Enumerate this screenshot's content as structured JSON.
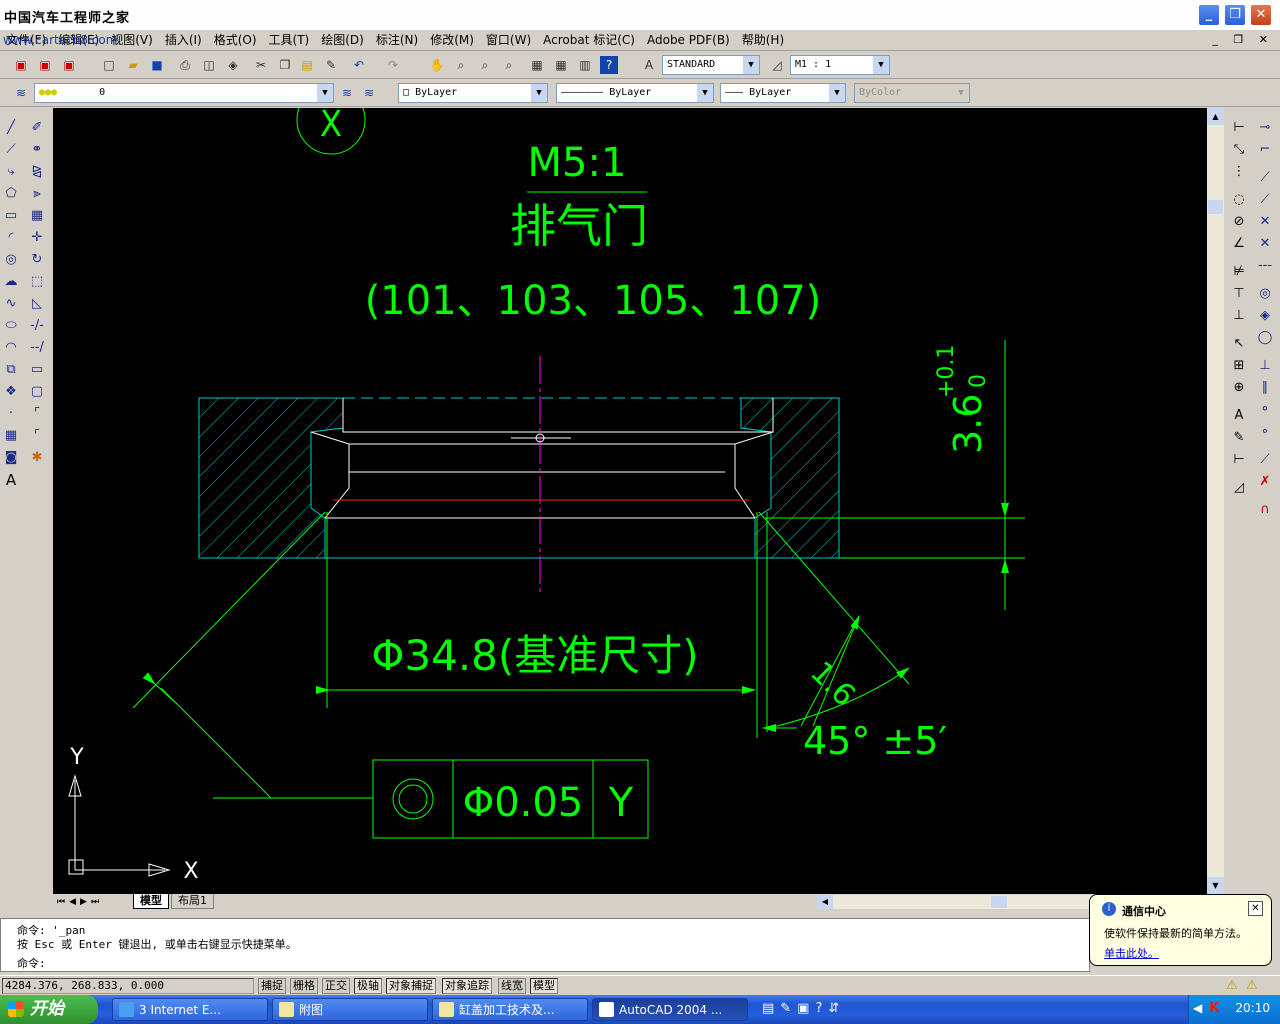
{
  "window": {
    "title": "中国汽车工程师之家",
    "url_overlay": "www.cartech8.com",
    "controls": [
      "_",
      "❐",
      "✕"
    ],
    "mdi_controls": "_ ❐ ✕"
  },
  "menu": [
    "文件(F)",
    "编辑(E)",
    "视图(V)",
    "插入(I)",
    "格式(O)",
    "工具(T)",
    "绘图(D)",
    "标注(N)",
    "修改(M)",
    "窗口(W)",
    "Acrobat 标记(C)",
    "Adobe PDF(B)",
    "帮助(H)"
  ],
  "toolbar1": {
    "text_style": "STANDARD",
    "dim_style": "M1 : 1"
  },
  "toolbar2": {
    "layer": "0",
    "color": "ByLayer",
    "linetype": "ByLayer",
    "lineweight": "ByLayer",
    "plotstyle": "ByColor"
  },
  "drawing": {
    "title_scale": "M5:1",
    "part_name": "排气门",
    "part_numbers": "(101、103、105、107)",
    "section_label": "X",
    "diameter_dim": "Φ34.8(基准尺寸)",
    "length_dim": "1.6",
    "angle_dim": "45°  ±5′",
    "height_dim": "3.6",
    "height_tol_upper": "+0.1",
    "height_tol_lower": "0",
    "fcf_tolerance": "Φ0.05",
    "fcf_datum": "Y",
    "ucs_x": "X",
    "ucs_y": "Y"
  },
  "tabs": [
    "模型",
    "布局1"
  ],
  "command": {
    "line1": "命令: '_pan",
    "line2": "按 Esc 或 Enter 键退出, 或单击右键显示快捷菜单。",
    "line3": "命令:"
  },
  "status": {
    "coords": "4284.376, 268.833, 0.000",
    "buttons": [
      "捕捉",
      "栅格",
      "正交",
      "极轴",
      "对象捕捉",
      "对象追踪",
      "线宽",
      "模型"
    ]
  },
  "balloon": {
    "title": "通信中心",
    "body": "使软件保持最新的简单方法。",
    "link": "单击此处。"
  },
  "taskbar": {
    "start": "开始",
    "tasks": [
      "3 Internet E...",
      "附图",
      "缸盖加工技术及...",
      "AutoCAD 2004 ..."
    ],
    "clock": "20:10"
  }
}
